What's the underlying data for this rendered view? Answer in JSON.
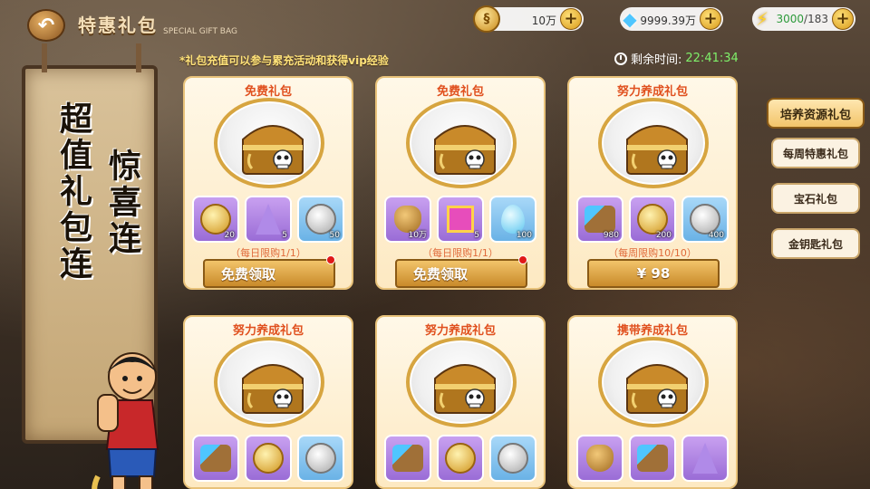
{
  "header": {
    "back_icon": "back-arrow-icon",
    "title": "特惠礼包",
    "subtitle": "SPECIAL GIFT BAG"
  },
  "resources": {
    "coins": "10万",
    "gems": "9999.39万",
    "energy_current": "3000",
    "energy_max": "/183"
  },
  "notice": "*礼包充值可以参与累充活动和获得vip经验",
  "timer": {
    "label": "剩余时间:",
    "value": "22:41:34"
  },
  "banner": {
    "col1": "超值礼包连",
    "col2": "惊喜连"
  },
  "cards": [
    {
      "name": "免费礼包",
      "items": [
        {
          "type": "gold-coin",
          "qty": "20",
          "bg": "purple"
        },
        {
          "type": "crystal",
          "qty": "5",
          "bg": "purple"
        },
        {
          "type": "silver-coin",
          "qty": "50",
          "bg": "blue"
        }
      ],
      "limit": "（每日限购1/1）",
      "button": "免费领取",
      "red_dot": true
    },
    {
      "name": "免费礼包",
      "items": [
        {
          "type": "money-bag",
          "qty": "10万",
          "bg": "purple"
        },
        {
          "type": "gift-box",
          "qty": "5",
          "bg": "purple"
        },
        {
          "type": "water-drop",
          "qty": "100",
          "bg": "blue"
        }
      ],
      "limit": "（每日限购1/1）",
      "button": "免费领取",
      "red_dot": true
    },
    {
      "name": "努力养成礼包",
      "items": [
        {
          "type": "mixed-pack",
          "qty": "980",
          "bg": "purple"
        },
        {
          "type": "gold-coin",
          "qty": "200",
          "bg": "purple"
        },
        {
          "type": "silver-coin",
          "qty": "400",
          "bg": "blue"
        }
      ],
      "limit": "（每周限购10/10）",
      "button": "¥ 98",
      "red_dot": false
    },
    {
      "name": "努力养成礼包",
      "items": [
        {
          "type": "mixed-pack",
          "qty": "",
          "bg": "purple"
        },
        {
          "type": "gold-coin",
          "qty": "",
          "bg": "purple"
        },
        {
          "type": "silver-coin",
          "qty": "",
          "bg": "blue"
        }
      ]
    },
    {
      "name": "努力养成礼包",
      "items": [
        {
          "type": "mixed-pack",
          "qty": "",
          "bg": "purple"
        },
        {
          "type": "gold-coin",
          "qty": "",
          "bg": "purple"
        },
        {
          "type": "silver-coin",
          "qty": "",
          "bg": "blue"
        }
      ]
    },
    {
      "name": "携带养成礼包",
      "items": [
        {
          "type": "money-bag",
          "qty": "",
          "bg": "purple"
        },
        {
          "type": "mixed-pack",
          "qty": "",
          "bg": "purple"
        },
        {
          "type": "crystal",
          "qty": "",
          "bg": "purple"
        }
      ]
    }
  ],
  "tabs": [
    {
      "label": "培养资源礼包",
      "active": true
    },
    {
      "label": "每周特惠礼包",
      "active": false
    },
    {
      "label": "宝石礼包",
      "active": false
    },
    {
      "label": "金钥匙礼包",
      "active": false
    }
  ],
  "colors": {
    "title_red": "#e0501e",
    "notice_yellow": "#ffe37a",
    "timer_green": "#7ff06a",
    "button_gold": "#c98a2a"
  }
}
